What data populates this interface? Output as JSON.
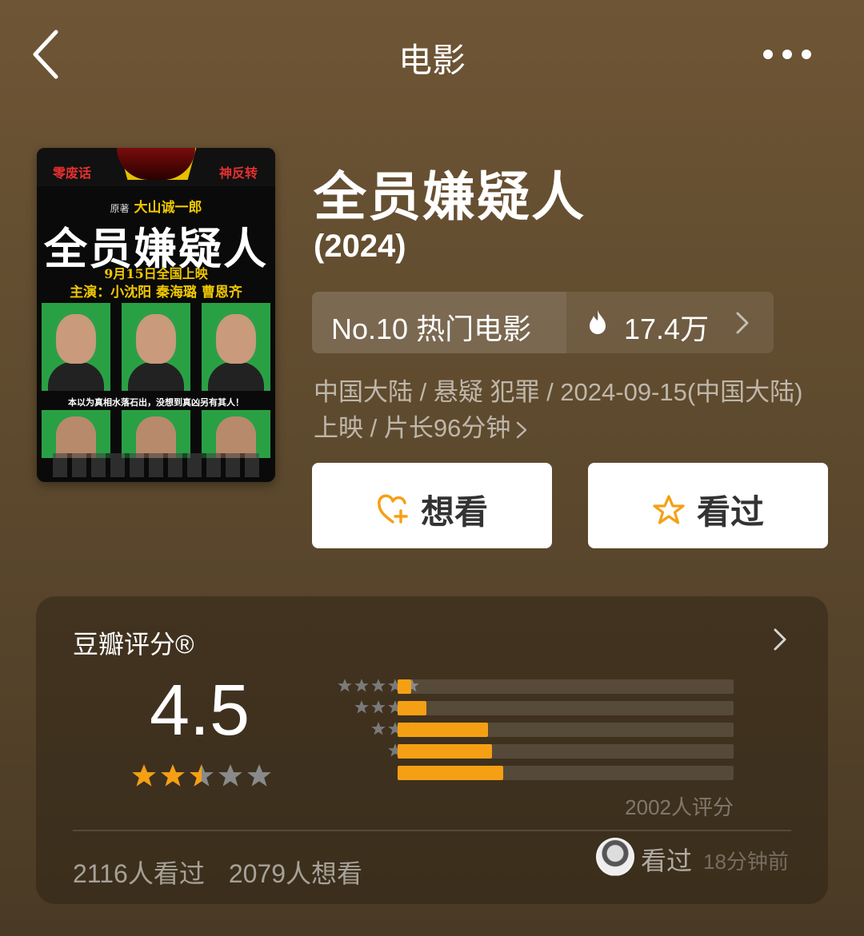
{
  "header": {
    "title": "电影"
  },
  "poster": {
    "tag_left": "零废话",
    "tag_right": "神反转",
    "author_prefix": "原著",
    "author": "大山诚一郎",
    "title": "全员嫌疑人",
    "release": "9月15日全国上映",
    "cast": "主演：小沈阳  秦海璐  曹恩齐",
    "tagline": "本以为真相水落石出，没想到真凶另有其人！"
  },
  "movie": {
    "title": "全员嫌疑人",
    "year": "(2024)",
    "rank_label": "No.10 热门电影",
    "heat": "17.4万",
    "meta": "中国大陆 / 悬疑 犯罪 / 2024-09-15(中国大陆)上映 / 片长96分钟"
  },
  "actions": {
    "want": "想看",
    "watched": "看过"
  },
  "rating": {
    "label": "豆瓣评分®",
    "score": "4.5",
    "stars_value": 2.5,
    "distribution": [
      {
        "stars": 5,
        "fraction": 0.04
      },
      {
        "stars": 4,
        "fraction": 0.085
      },
      {
        "stars": 3,
        "fraction": 0.27
      },
      {
        "stars": 2,
        "fraction": 0.28
      },
      {
        "stars": 1,
        "fraction": 0.315
      }
    ],
    "count": "2002人评分",
    "seen": "2116人看过",
    "wanted": "2079人想看",
    "activity_action": "看过",
    "activity_time": "18分钟前"
  },
  "colors": {
    "accent": "#f5a014",
    "star_on": "#f5a014",
    "star_off": "#8a8a8a",
    "background_top": "#6e5535",
    "background_bottom": "#4a3a25"
  },
  "icons": [
    "back-icon",
    "more-icon",
    "fire-icon",
    "chevron-right-icon",
    "heart-plus-icon",
    "star-outline-icon",
    "star-icon"
  ]
}
